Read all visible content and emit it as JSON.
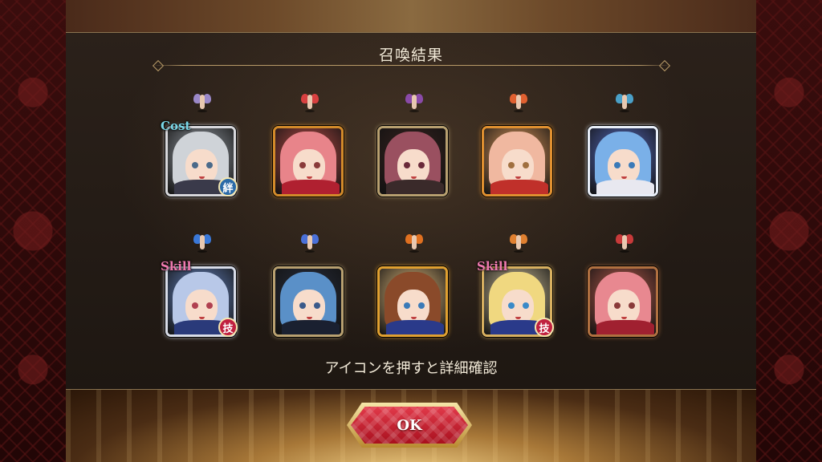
{
  "dialog": {
    "title": "召喚結果",
    "hint": "アイコンを押すと詳細確認",
    "ok_label": "OK"
  },
  "units": [
    {
      "frame": "silver",
      "frame_color": "#d8d8dc",
      "bg": "#9aa0a8",
      "hair": "#cfd3d8",
      "eyes": "#4a6a8a",
      "clothes": "#3a3a4a",
      "sprite_color": "#9a88c8",
      "badge_tl": "Cost",
      "badge_tl_color": "#7ad8e8",
      "badge_br": "絆",
      "badge_br_color": "#2a6aa8"
    },
    {
      "frame": "gold",
      "frame_color": "#d28a2a",
      "bg": "#c0504a",
      "hair": "#e8848a",
      "eyes": "#8a3a3a",
      "clothes": "#b02030",
      "sprite_color": "#d84040",
      "badge_tl": "",
      "badge_tl_color": "",
      "badge_br": "",
      "badge_br_color": ""
    },
    {
      "frame": "black",
      "frame_color": "#b8a070",
      "bg": "#3a2420",
      "hair": "#9a5060",
      "eyes": "#6a2a3a",
      "clothes": "#3a2a2a",
      "sprite_color": "#8a4aa8",
      "badge_tl": "",
      "badge_tl_color": "",
      "badge_br": "",
      "badge_br_color": ""
    },
    {
      "frame": "gold",
      "frame_color": "#e09030",
      "bg": "#e8a060",
      "hair": "#f0b8a0",
      "eyes": "#a07040",
      "clothes": "#c0302a",
      "sprite_color": "#e06030",
      "badge_tl": "",
      "badge_tl_color": "",
      "badge_br": "",
      "badge_br_color": ""
    },
    {
      "frame": "platinum",
      "frame_color": "#e8eef8",
      "bg": "#5a70c8",
      "hair": "#7ab0e8",
      "eyes": "#3a7ab8",
      "clothes": "#e8e8f0",
      "sprite_color": "#4aa0c8",
      "badge_tl": "",
      "badge_tl_color": "",
      "badge_br": "",
      "badge_br_color": ""
    },
    {
      "frame": "silver",
      "frame_color": "#d8dce8",
      "bg": "#6a8ac8",
      "hair": "#b8c8e8",
      "eyes": "#b04050",
      "clothes": "#2a3a7a",
      "sprite_color": "#3a78d8",
      "badge_tl": "Skill",
      "badge_tl_color": "#f07ab0",
      "badge_br": "技",
      "badge_br_color": "#c02040"
    },
    {
      "frame": "black",
      "frame_color": "#b8a070",
      "bg": "#2a3040",
      "hair": "#5a90c8",
      "eyes": "#3a5a8a",
      "clothes": "#1a2030",
      "sprite_color": "#4a70d8",
      "badge_tl": "",
      "badge_tl_color": "",
      "badge_br": "",
      "badge_br_color": ""
    },
    {
      "frame": "gold",
      "frame_color": "#e0a030",
      "bg": "#e8c080",
      "hair": "#8a4a2a",
      "eyes": "#3a7ab8",
      "clothes": "#2a3a8a",
      "sprite_color": "#e07020",
      "badge_tl": "",
      "badge_tl_color": "",
      "badge_br": "",
      "badge_br_color": ""
    },
    {
      "frame": "gold",
      "frame_color": "#d8b060",
      "bg": "#d8c8a0",
      "hair": "#f0d880",
      "eyes": "#3a8ac8",
      "clothes": "#2a3a8a",
      "sprite_color": "#e08030",
      "badge_tl": "Skill",
      "badge_tl_color": "#f07ab0",
      "badge_br": "技",
      "badge_br_color": "#c02040"
    },
    {
      "frame": "black",
      "frame_color": "#b07040",
      "bg": "#c06050",
      "hair": "#e88890",
      "eyes": "#8a3a3a",
      "clothes": "#a02030",
      "sprite_color": "#c83a3a",
      "badge_tl": "",
      "badge_tl_color": "",
      "badge_br": "",
      "badge_br_color": ""
    }
  ]
}
